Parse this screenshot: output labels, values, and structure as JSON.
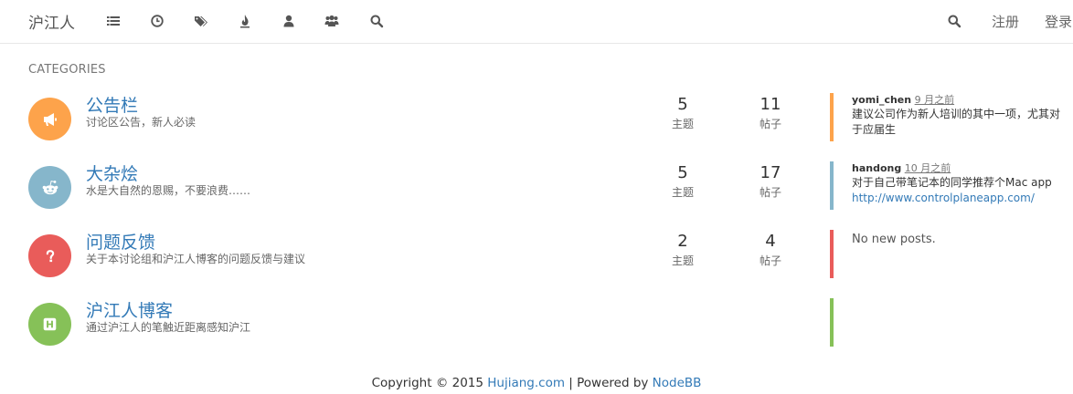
{
  "navbar": {
    "brand": "沪江人",
    "icons": [
      "list-icon",
      "clock-icon",
      "tags-icon",
      "fire-icon",
      "user-icon",
      "users-icon",
      "search-icon"
    ],
    "right_search_icon": "search-icon",
    "register_label": "注册",
    "login_label": "登录"
  },
  "main": {
    "section_title": "CATEGORIES",
    "categories": [
      {
        "name": "公告栏",
        "description": "讨论区公告，新人必读",
        "icon": "bullhorn-icon",
        "color": "#fda34b",
        "topics": "5",
        "posts": "11",
        "topics_label": "主题",
        "posts_label": "帖子",
        "teaser": {
          "user": "yomi_chen",
          "time": "9 月之前",
          "content": "建议公司作为新人培训的其中一项，尤其对于应届生",
          "link": ""
        }
      },
      {
        "name": "大杂烩",
        "description": "水是大自然的恩赐，不要浪费……",
        "icon": "reddit-alien-icon",
        "color": "#86b6cb",
        "topics": "5",
        "posts": "17",
        "topics_label": "主题",
        "posts_label": "帖子",
        "teaser": {
          "user": "handong",
          "time": "10 月之前",
          "content": "对于自己带笔记本的同学推荐个Mac app",
          "link": "http://www.controlplaneapp.com/"
        }
      },
      {
        "name": "问题反馈",
        "description": "关于本讨论组和沪江人博客的问题反馈与建议",
        "icon": "question-icon",
        "color": "#e95c5a",
        "topics": "2",
        "posts": "4",
        "topics_label": "主题",
        "posts_label": "帖子",
        "no_posts": "No new posts."
      },
      {
        "name": "沪江人博客",
        "description": "通过沪江人的笔触近距离感知沪江",
        "icon": "h-square-icon",
        "color": "#86c158"
      }
    ]
  },
  "footer": {
    "copyright": "Copyright © 2015 ",
    "site_link": "Hujiang.com",
    "separator": " | Powered by ",
    "nodebb_link": "NodeBB"
  }
}
